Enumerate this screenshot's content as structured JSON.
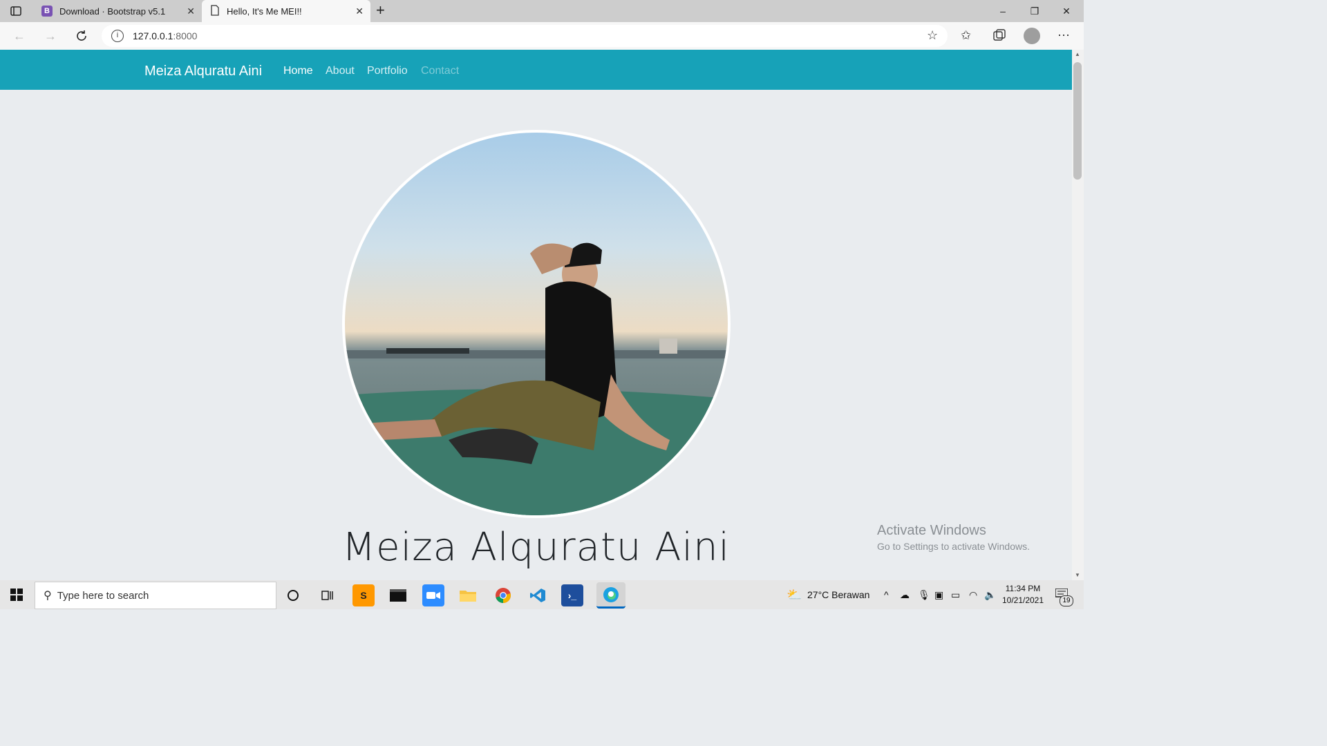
{
  "browser": {
    "tabs": [
      {
        "title": "Download · Bootstrap v5.1",
        "favicon": "B"
      },
      {
        "title": "Hello, It's Me MEI!!"
      }
    ],
    "new_tab": "+",
    "address": {
      "host": "127.0.0.1",
      "port": ":8000"
    },
    "window_controls": {
      "minimize": "–",
      "restore": "❐",
      "close": "✕"
    }
  },
  "page": {
    "brand": "Meiza Alquratu Aini",
    "nav": [
      {
        "label": "Home"
      },
      {
        "label": "About"
      },
      {
        "label": "Portfolio"
      },
      {
        "label": "Contact"
      }
    ],
    "nav_colors": {
      "active": "#ffffff",
      "inactive": "#d6f0f4",
      "disabled": "#7fcbd7"
    },
    "hero_name": "Meiza Alquratu Aini",
    "accent_color": "#17a2b8"
  },
  "watermark": {
    "title": "Activate Windows",
    "subtitle": "Go to Settings to activate Windows."
  },
  "taskbar": {
    "search_placeholder": "Type here to search",
    "weather": "27°C  Berawan",
    "time": "11:34 PM",
    "date": "10/21/2021",
    "notifications": "19"
  }
}
